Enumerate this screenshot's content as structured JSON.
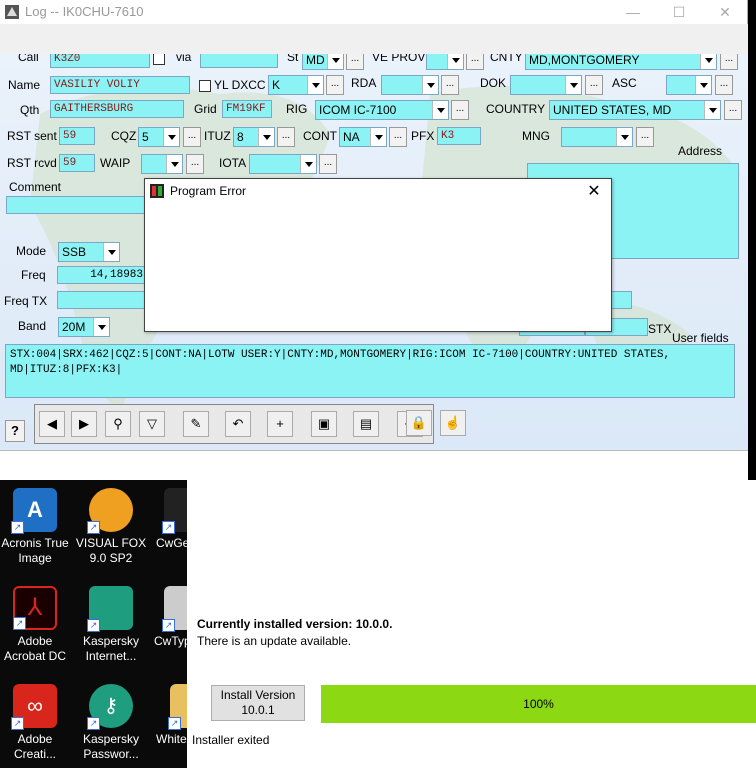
{
  "window": {
    "title": "Log -- IK0CHU-7610",
    "minimize": "—",
    "maximize": "☐",
    "close": "✕"
  },
  "form": {
    "call": {
      "label": "Call",
      "value": "K3Z0"
    },
    "via": {
      "label": "via",
      "value": ""
    },
    "st": {
      "label": "St",
      "value": "MD"
    },
    "ve_prov": {
      "label": "VE PROV",
      "value": ""
    },
    "cnty": {
      "label": "CNTY",
      "value": "MD,MONTGOMERY"
    },
    "name": {
      "label": "Name",
      "value": "VASILIY VOLIY"
    },
    "yl_dxcc": {
      "label": "YL DXCC",
      "value": "K"
    },
    "rda": {
      "label": "RDA",
      "value": ""
    },
    "dok": {
      "label": "DOK",
      "value": ""
    },
    "asc": {
      "label": "ASC",
      "value": ""
    },
    "qth": {
      "label": "Qth",
      "value": "GAITHERSBURG"
    },
    "grid": {
      "label": "Grid",
      "value": "FM19KF"
    },
    "rig": {
      "label": "RIG",
      "value": "ICOM IC-7100"
    },
    "country": {
      "label": "COUNTRY",
      "value": "UNITED STATES, MD"
    },
    "rst_sent": {
      "label": "RST sent",
      "value": "59"
    },
    "cqz": {
      "label": "CQZ",
      "value": "5"
    },
    "ituz": {
      "label": "ITUZ",
      "value": "8"
    },
    "cont": {
      "label": "CONT",
      "value": "NA"
    },
    "pfx": {
      "label": "PFX",
      "value": "K3"
    },
    "mng": {
      "label": "MNG",
      "value": ""
    },
    "address": {
      "label": "Address"
    },
    "rst_rcvd": {
      "label": "RST rcvd",
      "value": "59"
    },
    "waip": {
      "label": "WAIP",
      "value": ""
    },
    "iota": {
      "label": "IOTA",
      "value": ""
    },
    "comment": {
      "label": "Comment",
      "value": ""
    },
    "mode": {
      "label": "Mode",
      "value": "SSB"
    },
    "freq": {
      "label": "Freq",
      "value": "14,18983"
    },
    "freq_tx": {
      "label": "Freq TX",
      "value": ""
    },
    "band": {
      "label": "Band",
      "value": "20M"
    },
    "stx": {
      "label": "STX"
    },
    "user_fields": {
      "label": "User fields"
    },
    "notes": "STX:004|SRX:462|CQZ:5|CONT:NA|LOTW USER:Y|CNTY:MD,MONTGOMERY|RIG:ICOM IC-7100|COUNTRY:UNITED STATES, MD|ITUZ:8|PFX:K3|",
    "ellipsis": "..."
  },
  "toolbar": {
    "help": "?",
    "buttons": [
      {
        "icon": "prev-icon",
        "glyph": "◀"
      },
      {
        "icon": "next-icon",
        "glyph": "▶"
      },
      {
        "icon": "binoculars-icon",
        "glyph": "⚲"
      },
      {
        "icon": "filter-icon",
        "glyph": "▽"
      },
      {
        "icon": "eraser-icon",
        "glyph": "✎"
      },
      {
        "icon": "undo-icon",
        "glyph": "↶"
      },
      {
        "icon": "add-icon",
        "glyph": "+"
      },
      {
        "icon": "save-icon",
        "glyph": "▣"
      },
      {
        "icon": "table-icon",
        "glyph": "▤"
      },
      {
        "icon": "exit-icon",
        "glyph": "⇥"
      },
      {
        "icon": "lock-icon",
        "glyph": "🔒"
      },
      {
        "icon": "pointer-icon",
        "glyph": "☝"
      }
    ]
  },
  "dialog": {
    "title": "Program Error",
    "close": "✕"
  },
  "desktop": {
    "icons": [
      {
        "name": "acronis-icon",
        "label": "Acronis True Image"
      },
      {
        "name": "visual-fox-icon",
        "label": "VISUAL FOX 9.0 SP2"
      },
      {
        "name": "cwget-icon",
        "label": "CwGe"
      },
      {
        "name": "adobe-acrobat-icon",
        "label": "Adobe Acrobat DC"
      },
      {
        "name": "kaspersky-internet-icon",
        "label": "Kaspersky Internet..."
      },
      {
        "name": "cwtype-icon",
        "label": "CwTyp"
      },
      {
        "name": "adobe-creative-icon",
        "label": "Adobe Creati..."
      },
      {
        "name": "kaspersky-password-icon",
        "label": "Kaspersky Passwor..."
      },
      {
        "name": "white-icon",
        "label": "White"
      }
    ]
  },
  "installer": {
    "current_version": "Currently installed version: 10.0.0.",
    "update_available": "There is an update available.",
    "install_button": "Install Version 10.0.1",
    "progress": "100%",
    "progress_value": 1.0,
    "status": "Installer exited"
  },
  "colors": {
    "field": "#8cf3f5",
    "progress": "#8cd812"
  }
}
